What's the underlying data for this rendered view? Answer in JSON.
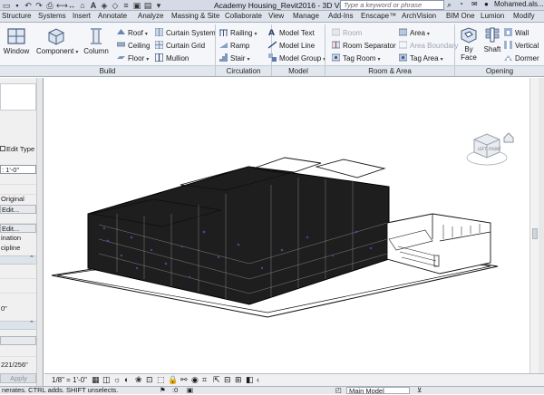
{
  "window": {
    "title": "Academy Housing_Revit2016 - 3D View...",
    "search_placeholder": "Type a keyword or phrase",
    "user": "Mohamed.als..."
  },
  "tabs": [
    "Structure",
    "Systems",
    "Insert",
    "Annotate",
    "Analyze",
    "Massing & Site",
    "Collaborate",
    "View",
    "Manage",
    "Add-Ins",
    "Enscape™",
    "ArchVision",
    "BIM One",
    "Lumion",
    "Modify"
  ],
  "ribbon": {
    "build": {
      "label": "Build",
      "window": "Window",
      "component": "Component",
      "column": "Column",
      "roof": "Roof",
      "ceiling": "Ceiling",
      "floor": "Floor",
      "curtain_system": "Curtain System",
      "curtain_grid": "Curtain Grid",
      "mullion": "Mullion"
    },
    "circulation": {
      "label": "Circulation",
      "railing": "Railing",
      "ramp": "Ramp",
      "stair": "Stair"
    },
    "model": {
      "label": "Model",
      "model_text": "Model Text",
      "model_line": "Model Line",
      "model_group": "Model Group"
    },
    "room_area": {
      "label": "Room & Area",
      "room": "Room",
      "room_separator": "Room Separator",
      "tag_room": "Tag Room",
      "area": "Area",
      "area_boundary": "Area Boundary",
      "tag_area": "Tag Area"
    },
    "opening": {
      "label": "Opening",
      "by_face": "By Face",
      "shaft": "Shaft",
      "wall": "Wall",
      "vertical": "Vertical",
      "dormer": "Dormer"
    }
  },
  "properties": {
    "edit_type": "Edit Type",
    "scale": ": 1'-0\"",
    "original": "Original",
    "edit1": "Edit...",
    "edit2": "Edit...",
    "coordination": "ination",
    "discipline": "cipline",
    "zero": "0\"",
    "dims": "221/256\"",
    "apply": "Apply"
  },
  "viewbar": {
    "scale": "1/8\" = 1'-0\""
  },
  "status": {
    "message": "nerates. CTRL adds. SHIFT unselects.",
    "model": "Main Model",
    "zero": ":0"
  },
  "colors": {
    "ribbon_bg": "#f4f6f9",
    "tab_bg": "#dfe4ec",
    "model_line": "#111111",
    "model_accent": "#3a4e8a"
  }
}
